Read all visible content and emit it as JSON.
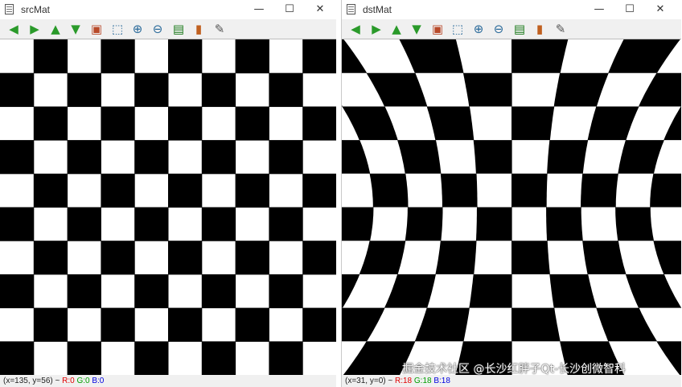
{
  "src_window": {
    "title": "srcMat",
    "status": {
      "coords": "(x=135, y=56) ~",
      "r": "R:0",
      "g": "G:0",
      "b": "B:0"
    }
  },
  "dst_window": {
    "title": "dstMat",
    "status": {
      "coords": "(x=31, y=0) ~",
      "r": "R:18",
      "g": "G:18",
      "b": "B:18"
    }
  },
  "window_controls": {
    "minimize": "—",
    "maximize": "☐",
    "close": "✕"
  },
  "toolbar_icons": [
    "arrow-left-icon",
    "arrow-right-icon",
    "arrow-up-icon",
    "arrow-down-icon",
    "image-icon",
    "select-region-icon",
    "zoom-in-icon",
    "zoom-out-icon",
    "save-icon",
    "clipboard-icon",
    "brush-icon"
  ],
  "checkerboard": {
    "rows": 10,
    "cols": 10,
    "dark_color": "#000000",
    "light_color": "#ffffff",
    "distortion": "barrel"
  },
  "watermark": "掘金技术社区 @长沙红胖子Qt-长沙创微智科"
}
